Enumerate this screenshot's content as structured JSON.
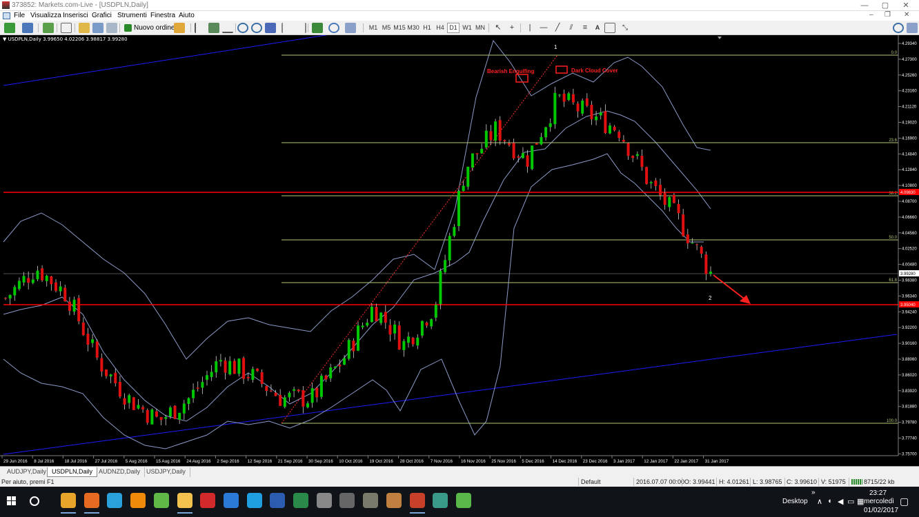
{
  "window": {
    "title": "373852: Markets.com-Live - [USDPLN,Daily]",
    "controls": {
      "minimize": "—",
      "maximize": "▢",
      "close": "✕"
    }
  },
  "menu": {
    "items": [
      "File",
      "Visualizza",
      "Inserisci",
      "Grafici",
      "Strumenti",
      "Finestra",
      "Aiuto"
    ],
    "mdi_controls": {
      "minimize": "–",
      "restore": "❐",
      "close": "✕"
    }
  },
  "toolbar": {
    "new_order": "Nuovo ordine",
    "timeframes": [
      "M1",
      "M5",
      "M15",
      "M30",
      "H1",
      "H4",
      "D1",
      "W1",
      "MN"
    ],
    "active_timeframe": "D1",
    "text_tool": "A"
  },
  "chart": {
    "symbol_info": "USDPLN,Daily  3.99650 4.02206 3.98817 3.99280",
    "price_labels": [
      "4.29340",
      "4.27300",
      "4.25260",
      "4.23160",
      "4.21120",
      "4.19020",
      "4.16900",
      "4.14840",
      "4.12840",
      "4.10800",
      "4.08700",
      "4.06660",
      "4.04560",
      "4.02520",
      "4.00480",
      "3.98380",
      "3.96340",
      "3.94240",
      "3.92200",
      "3.90160",
      "3.88060",
      "3.86020",
      "3.83920",
      "3.81880",
      "3.79780",
      "3.77740",
      "3.75700"
    ],
    "current_price": "3.99280",
    "hline_labels": [
      "4.09830",
      "3.95040"
    ],
    "date_labels": [
      "29 Jun 2016",
      "8 Jul 2016",
      "18 Jul 2016",
      "27 Jul 2016",
      "5 Aug 2016",
      "15 Aug 2016",
      "24 Aug 2016",
      "2 Sep 2016",
      "12 Sep 2016",
      "21 Sep 2016",
      "30 Sep 2016",
      "10 Oct 2016",
      "19 Oct 2016",
      "28 Oct 2016",
      "7 Nov 2016",
      "16 Nov 2016",
      "25 Nov 2016",
      "5 Dec 2016",
      "14 Dec 2016",
      "23 Dec 2016",
      "3 Jan 2017",
      "12 Jan 2017",
      "22 Jan 2017",
      "31 Jan 2017"
    ],
    "fib_labels": [
      "0.0",
      "23.6",
      "38.2",
      "50.0",
      "61.8",
      "100.0"
    ],
    "annotations": {
      "bearish": "Bearish Engulfing",
      "dark_cloud": "Dark Cloud Cover",
      "point1": "1",
      "point2": "2"
    },
    "colors": {
      "background": "#000000",
      "bull_candle": "#00c800",
      "bear_candle": "#e01010",
      "bollinger": "#8c9ac8",
      "fib": "#b5c77a",
      "hline": "#ff0000",
      "trendline": "#1c1cff",
      "annotation": "#ff2020"
    }
  },
  "chart_data": {
    "type": "candlestick",
    "symbol": "USDPLN",
    "timeframe": "Daily",
    "ohlc_last": {
      "open": 3.9965,
      "high": 4.02206,
      "low": 3.98817,
      "close": 3.9928
    },
    "price_range": [
      3.757,
      4.2934
    ],
    "fibonacci": [
      {
        "level": "0.0",
        "price": 4.278
      },
      {
        "level": "23.6",
        "price": 4.163
      },
      {
        "level": "38.2",
        "price": 4.091
      },
      {
        "level": "50.0",
        "price": 4.034
      },
      {
        "level": "61.8",
        "price": 3.977
      },
      {
        "level": "100.0",
        "price": 3.791
      }
    ],
    "horizontal_lines": [
      4.0983,
      3.9504
    ],
    "close_path": [
      {
        "date": "29 Jun 2016",
        "close": 3.96
      },
      {
        "date": "8 Jul 2016",
        "close": 4.0
      },
      {
        "date": "18 Jul 2016",
        "close": 3.965
      },
      {
        "date": "27 Jul 2016",
        "close": 3.88
      },
      {
        "date": "5 Aug 2016",
        "close": 3.83
      },
      {
        "date": "15 Aug 2016",
        "close": 3.8
      },
      {
        "date": "24 Aug 2016",
        "close": 3.83
      },
      {
        "date": "2 Sep 2016",
        "close": 3.88
      },
      {
        "date": "12 Sep 2016",
        "close": 3.86
      },
      {
        "date": "21 Sep 2016",
        "close": 3.83
      },
      {
        "date": "30 Sep 2016",
        "close": 3.83
      },
      {
        "date": "10 Oct 2016",
        "close": 3.88
      },
      {
        "date": "19 Oct 2016",
        "close": 3.95
      },
      {
        "date": "28 Oct 2016",
        "close": 3.9
      },
      {
        "date": "7 Nov 2016",
        "close": 3.95
      },
      {
        "date": "16 Nov 2016",
        "close": 4.13
      },
      {
        "date": "25 Nov 2016",
        "close": 4.18
      },
      {
        "date": "5 Dec 2016",
        "close": 4.14
      },
      {
        "date": "14 Dec 2016",
        "close": 4.22
      },
      {
        "date": "23 Dec 2016",
        "close": 4.2
      },
      {
        "date": "3 Jan 2017",
        "close": 4.18
      },
      {
        "date": "12 Jan 2017",
        "close": 4.11
      },
      {
        "date": "22 Jan 2017",
        "close": 4.06
      },
      {
        "date": "31 Jan 2017",
        "close": 3.993
      }
    ]
  },
  "tabs": [
    {
      "label": "AUDJPY,Daily",
      "active": false
    },
    {
      "label": "USDPLN,Daily",
      "active": true
    },
    {
      "label": "AUDNZD,Daily",
      "active": false
    },
    {
      "label": "USDJPY,Daily",
      "active": false
    }
  ],
  "status": {
    "help": "Per aiuto, premi F1",
    "profile": "Default",
    "datetime": "2016.07.07 00:00",
    "open": "O: 3.99441",
    "high": "H: 4.01261",
    "low": "L: 3.98765",
    "close": "C: 3.99610",
    "volume": "V: 51975",
    "traffic": "8715/22 kb"
  },
  "taskbar": {
    "desktop": "Desktop",
    "time": "23:27",
    "day": "mercoledì",
    "date": "01/02/2017",
    "apps": [
      {
        "name": "chrome-app",
        "color": "#e8a52a",
        "open": true
      },
      {
        "name": "firefox-app",
        "color": "#e66a1f",
        "open": true
      },
      {
        "name": "telegram-app",
        "color": "#2aa1da",
        "open": false
      },
      {
        "name": "vlc-app",
        "color": "#f08a0a",
        "open": false
      },
      {
        "name": "utorrent-app",
        "color": "#60b846",
        "open": false
      },
      {
        "name": "explorer-app",
        "color": "#f2c14e",
        "open": true
      },
      {
        "name": "acrobat-app",
        "color": "#d22a2a",
        "open": false
      },
      {
        "name": "dropbox-app",
        "color": "#2a7ad8",
        "open": false
      },
      {
        "name": "skype-app",
        "color": "#1f9ee0",
        "open": false
      },
      {
        "name": "word-app",
        "color": "#2b5cb0",
        "open": false
      },
      {
        "name": "excel-app",
        "color": "#2a8a4a",
        "open": false
      },
      {
        "name": "tool-app",
        "color": "#888888",
        "open": false
      },
      {
        "name": "media-app",
        "color": "#666666",
        "open": false
      },
      {
        "name": "terminal-app",
        "color": "#7a7a6a",
        "open": false
      },
      {
        "name": "game-app",
        "color": "#c08040",
        "open": false
      },
      {
        "name": "mt4-app",
        "color": "#c8402a",
        "open": true
      },
      {
        "name": "notes-app",
        "color": "#3a9a8a",
        "open": false
      },
      {
        "name": "chat-app",
        "color": "#5ab84a",
        "open": false
      }
    ]
  }
}
